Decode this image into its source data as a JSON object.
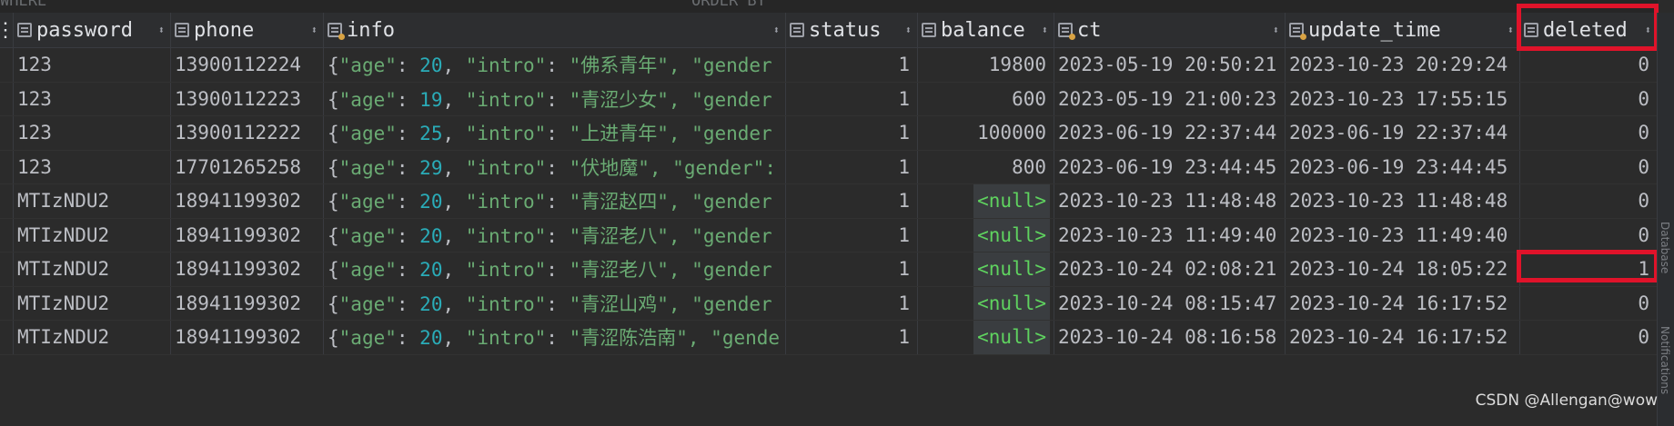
{
  "top_fragments": [
    "WHERE",
    "ORDER BY"
  ],
  "columns": [
    {
      "name": "password"
    },
    {
      "name": "phone"
    },
    {
      "name": "info"
    },
    {
      "name": "status"
    },
    {
      "name": "balance"
    },
    {
      "name": "ct"
    },
    {
      "name": "update_time"
    },
    {
      "name": "deleted"
    }
  ],
  "rows": [
    {
      "password": "123",
      "phone": "13900112224",
      "info": {
        "age": "20",
        "intro": "佛系青年",
        "tail": ", \"gender"
      },
      "status": "1",
      "balance": "19800",
      "ct": "2023-05-19 20:50:21",
      "update_time": "2023-10-23 20:29:24",
      "deleted": "0"
    },
    {
      "password": "123",
      "phone": "13900112223",
      "info": {
        "age": "19",
        "intro": "青涩少女",
        "tail": ", \"gender"
      },
      "status": "1",
      "balance": "600",
      "ct": "2023-05-19 21:00:23",
      "update_time": "2023-10-23 17:55:15",
      "deleted": "0"
    },
    {
      "password": "123",
      "phone": "13900112222",
      "info": {
        "age": "25",
        "intro": "上进青年",
        "tail": ", \"gender"
      },
      "status": "1",
      "balance": "100000",
      "ct": "2023-06-19 22:37:44",
      "update_time": "2023-06-19 22:37:44",
      "deleted": "0"
    },
    {
      "password": "123",
      "phone": "17701265258",
      "info": {
        "age": "29",
        "intro": "伏地魔",
        "tail": ", \"gender\":"
      },
      "status": "1",
      "balance": "800",
      "ct": "2023-06-19 23:44:45",
      "update_time": "2023-06-19 23:44:45",
      "deleted": "0"
    },
    {
      "password": "MTIzNDU2",
      "phone": "18941199302",
      "info": {
        "age": "20",
        "intro": "青涩赵四",
        "tail": ", \"gender"
      },
      "status": "1",
      "balance": "<null>",
      "ct": "2023-10-23 11:48:48",
      "update_time": "2023-10-23 11:48:48",
      "deleted": "0"
    },
    {
      "password": "MTIzNDU2",
      "phone": "18941199302",
      "info": {
        "age": "20",
        "intro": "青涩老八",
        "tail": ", \"gender"
      },
      "status": "1",
      "balance": "<null>",
      "ct": "2023-10-23 11:49:40",
      "update_time": "2023-10-23 11:49:40",
      "deleted": "0"
    },
    {
      "password": "MTIzNDU2",
      "phone": "18941199302",
      "info": {
        "age": "20",
        "intro": "青涩老八",
        "tail": ", \"gender"
      },
      "status": "1",
      "balance": "<null>",
      "ct": "2023-10-24 02:08:21",
      "update_time": "2023-10-24 18:05:22",
      "deleted": "1"
    },
    {
      "password": "MTIzNDU2",
      "phone": "18941199302",
      "info": {
        "age": "20",
        "intro": "青涩山鸡",
        "tail": ", \"gender"
      },
      "status": "1",
      "balance": "<null>",
      "ct": "2023-10-24 08:15:47",
      "update_time": "2023-10-24 16:17:52",
      "deleted": "0"
    },
    {
      "password": "MTIzNDU2",
      "phone": "18941199302",
      "info": {
        "age": "20",
        "intro": "青涩陈浩南",
        "tail": ", \"gende"
      },
      "status": "1",
      "balance": "<null>",
      "ct": "2023-10-24 08:16:58",
      "update_time": "2023-10-24 16:17:52",
      "deleted": "0"
    }
  ],
  "sidebar_labels": [
    "Database",
    "Notifications"
  ],
  "watermark": "CSDN @Allengan@wow",
  "colors": {
    "highlight": "#e0132a",
    "null_text": "#5fd35f",
    "json_key": "#6aab73",
    "json_number": "#2aacb8"
  }
}
